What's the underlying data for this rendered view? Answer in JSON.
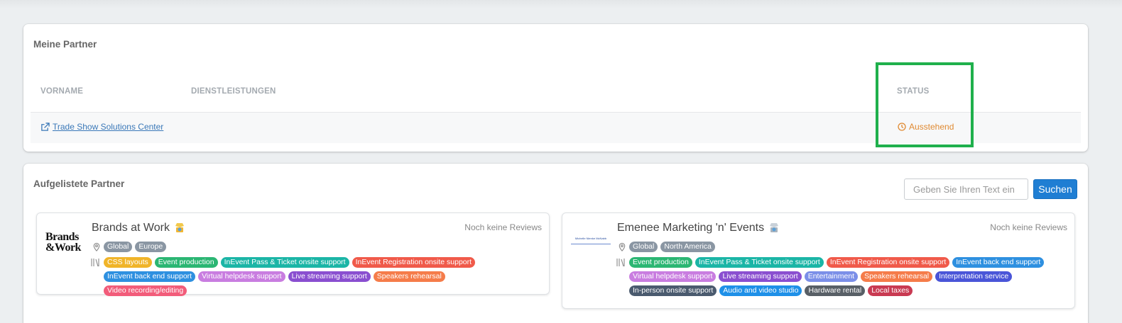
{
  "mine": {
    "title": "Meine Partner",
    "col_vorname": "VORNAME",
    "col_dienst": "DIENSTLEISTUNGEN",
    "col_status": "STATUS",
    "row": {
      "name": "Trade Show Solutions Center",
      "status": "Ausstehend"
    }
  },
  "listed": {
    "title": "Aufgelistete Partner",
    "search_placeholder": "Geben Sie Ihren Text ein",
    "search_button": "Suchen",
    "cards": [
      {
        "name": "Brands at Work",
        "logo_text": "Brands at Work",
        "reviews": "Noch keine Reviews",
        "locations": [
          "Global",
          "Europe"
        ],
        "services": [
          {
            "label": "CSS layouts",
            "color": "#f0b429"
          },
          {
            "label": "Event production",
            "color": "#2bb673"
          },
          {
            "label": "InEvent Pass & Ticket onsite support",
            "color": "#1bb5a6"
          },
          {
            "label": "InEvent Registration onsite support",
            "color": "#f05a4a"
          },
          {
            "label": "InEvent back end support",
            "color": "#2e90e0"
          },
          {
            "label": "Virtual helpdesk support",
            "color": "#c97de0"
          },
          {
            "label": "Live streaming support",
            "color": "#8a4fd0"
          },
          {
            "label": "Speakers rehearsal",
            "color": "#f57c4a"
          },
          {
            "label": "Video recording/editing",
            "color": "#f25c7a"
          }
        ]
      },
      {
        "name": "Emenee Marketing 'n' Events",
        "logo_text": "Michelle Nienke McNabb",
        "reviews": "Noch keine Reviews",
        "locations": [
          "Global",
          "North America"
        ],
        "services": [
          {
            "label": "Event production",
            "color": "#2bb673"
          },
          {
            "label": "InEvent Pass & Ticket onsite support",
            "color": "#1bb5a6"
          },
          {
            "label": "InEvent Registration onsite support",
            "color": "#f05a4a"
          },
          {
            "label": "InEvent back end support",
            "color": "#2e90e0"
          },
          {
            "label": "Virtual helpdesk support",
            "color": "#c97de0"
          },
          {
            "label": "Live streaming support",
            "color": "#8a4fd0"
          },
          {
            "label": "Entertainment",
            "color": "#7b8fe8"
          },
          {
            "label": "Speakers rehearsal",
            "color": "#f57c4a"
          },
          {
            "label": "Interpretation service",
            "color": "#4a55d8"
          },
          {
            "label": "In-person onsite support",
            "color": "#4a5a6e"
          },
          {
            "label": "Audio and video studio",
            "color": "#1e90e8"
          },
          {
            "label": "Hardware rental",
            "color": "#585f66"
          },
          {
            "label": "Local taxes",
            "color": "#c93a52"
          }
        ]
      }
    ]
  },
  "colors": {
    "accent": "#1f7ed3",
    "status_pending": "#e08a32",
    "highlight": "#1fb04c",
    "link": "#3a78b8"
  }
}
